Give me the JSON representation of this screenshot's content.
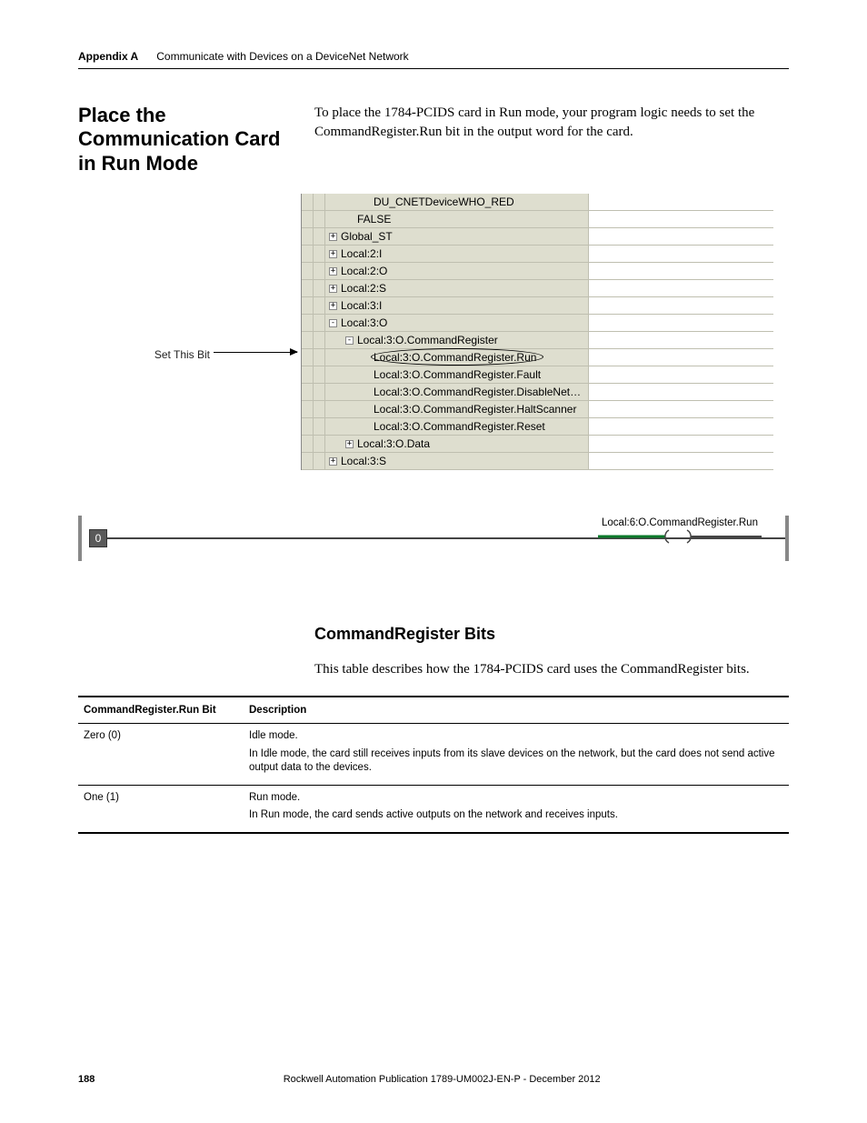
{
  "header": {
    "appendix": "Appendix A",
    "title": "Communicate with Devices on a DeviceNet Network"
  },
  "section": {
    "title": "Place the Communication Card in Run Mode",
    "intro": "To place the 1784-PCIDS card in Run mode, your program logic needs to set the CommandRegister.Run bit in the output word for the card."
  },
  "tree": {
    "annotation": "Set This Bit",
    "rows": [
      {
        "exp": "",
        "indent": 2,
        "text": "DU_CNETDeviceWHO_RED"
      },
      {
        "exp": "",
        "indent": 1,
        "text": "FALSE"
      },
      {
        "exp": "+",
        "indent": 0,
        "text": "Global_ST"
      },
      {
        "exp": "+",
        "indent": 0,
        "text": "Local:2:I"
      },
      {
        "exp": "+",
        "indent": 0,
        "text": "Local:2:O"
      },
      {
        "exp": "+",
        "indent": 0,
        "text": "Local:2:S"
      },
      {
        "exp": "+",
        "indent": 0,
        "text": "Local:3:I"
      },
      {
        "exp": "-",
        "indent": 0,
        "text": "Local:3:O"
      },
      {
        "exp": "-",
        "indent": 1,
        "text": "Local:3:O.CommandRegister"
      },
      {
        "exp": "",
        "indent": 2,
        "text": "Local:3:O.CommandRegister.Run",
        "highlight": true
      },
      {
        "exp": "",
        "indent": 2,
        "text": "Local:3:O.CommandRegister.Fault"
      },
      {
        "exp": "",
        "indent": 2,
        "text": "Local:3:O.CommandRegister.DisableNet…"
      },
      {
        "exp": "",
        "indent": 2,
        "text": "Local:3:O.CommandRegister.HaltScanner"
      },
      {
        "exp": "",
        "indent": 2,
        "text": "Local:3:O.CommandRegister.Reset"
      },
      {
        "exp": "+",
        "indent": 1,
        "text": "Local:3:O.Data"
      },
      {
        "exp": "+",
        "indent": 0,
        "text": "Local:3:S"
      }
    ]
  },
  "rung": {
    "number": "0",
    "label": "Local:6:O.CommandRegister.Run"
  },
  "subsection": {
    "title": "CommandRegister Bits",
    "intro": "This table describes how the 1784-PCIDS card uses the CommandRegister bits."
  },
  "table": {
    "headers": [
      "CommandRegister.Run Bit",
      "Description"
    ],
    "rows": [
      {
        "bit": "Zero (0)",
        "desc1": "Idle mode.",
        "desc2": "In Idle mode, the card still receives inputs from its slave devices on the network, but the card does not send active output data to the devices."
      },
      {
        "bit": "One (1)",
        "desc1": "Run mode.",
        "desc2": "In Run mode, the card sends active outputs on the network and receives inputs."
      }
    ]
  },
  "footer": {
    "page": "188",
    "pub": "Rockwell Automation Publication 1789-UM002J-EN-P - December 2012"
  }
}
